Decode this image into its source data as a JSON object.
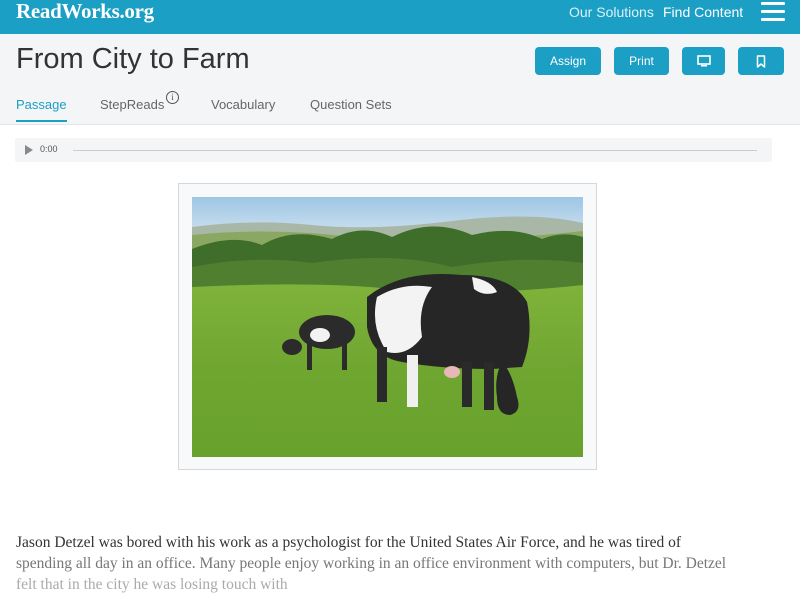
{
  "topbar": {
    "logo": "ReadWorks.org",
    "nav": [
      "Our Solutions",
      "Find Content"
    ]
  },
  "header": {
    "title": "From City to Farm",
    "buttons": {
      "assign": "Assign",
      "print": "Print"
    },
    "info_glyph": "i"
  },
  "tabs": [
    "Passage",
    "StepReads",
    "Vocabulary",
    "Question Sets"
  ],
  "audio": {
    "time": "0:00"
  },
  "passage": {
    "line1": "Jason Detzel was bored with his work as a psychologist for the United States Air Force, and he was tired of",
    "line2": "spending all day in an office. Many people enjoy working in an office environment with computers, but Dr. Detzel",
    "line3": "felt that in the city he was losing touch with"
  },
  "icons": [
    "menu-icon",
    "info-icon",
    "present-icon",
    "bookmark-icon",
    "play-icon"
  ],
  "colors": {
    "brand": "#1c9fc4",
    "header_bg": "#f4f5f6",
    "text": "#333333"
  }
}
